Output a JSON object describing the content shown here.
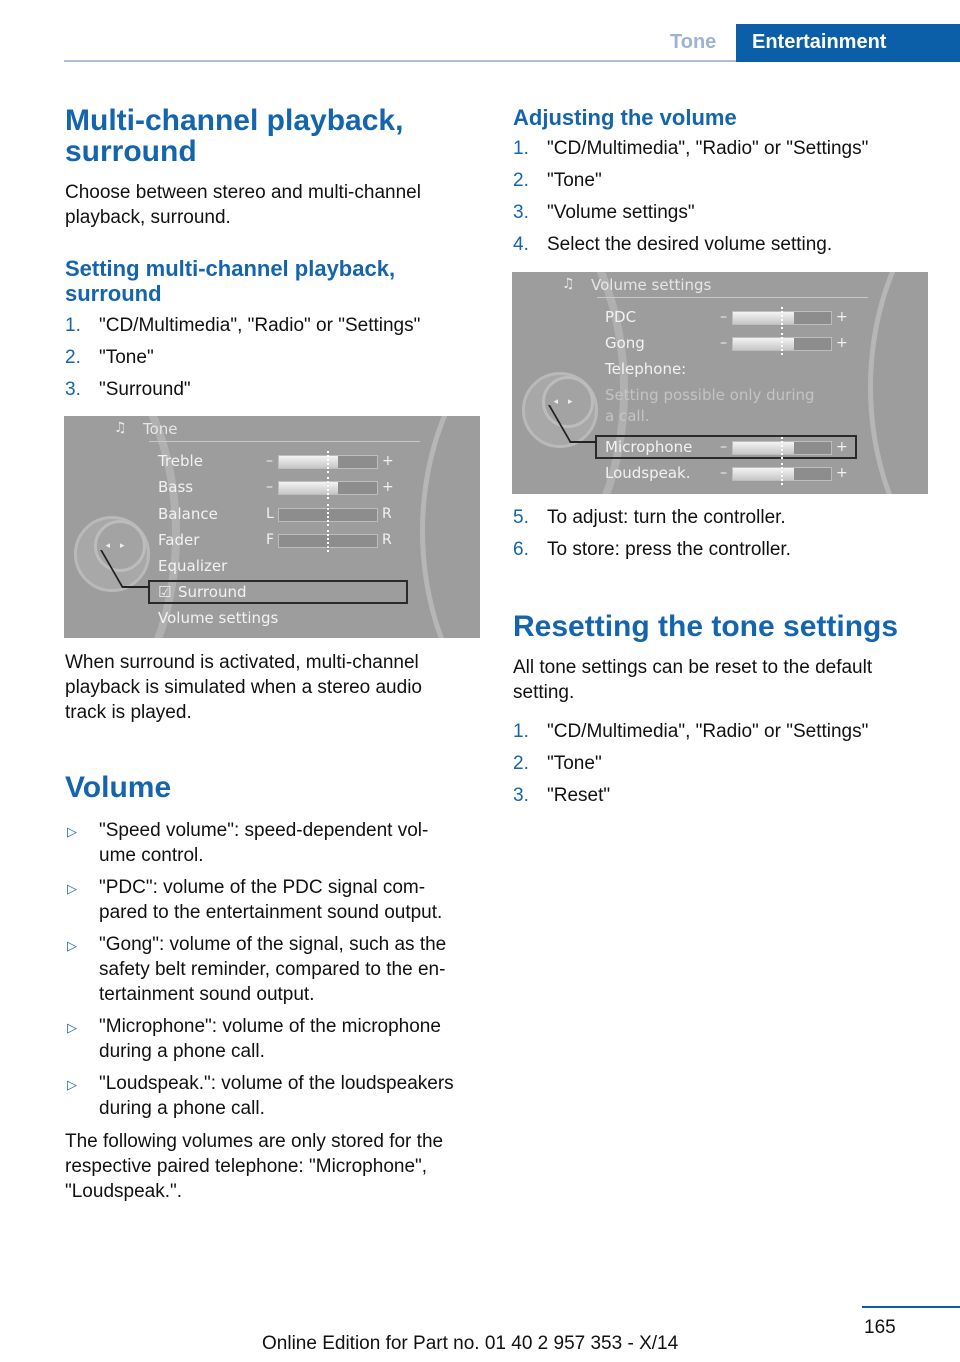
{
  "header": {
    "section": "Tone",
    "chapter": "Entertainment"
  },
  "left": {
    "title": "Multi-channel playback, surround",
    "intro": "Choose between stereo and multi-channel playback, surround.",
    "subtitle": "Setting multi-channel playback, surround",
    "steps": [
      {
        "n": "1.",
        "text": "\"CD/Multimedia\", \"Radio\" or \"Settings\""
      },
      {
        "n": "2.",
        "text": "\"Tone\""
      },
      {
        "n": "3.",
        "text": "\"Surround\""
      }
    ],
    "screen": {
      "title": "Tone",
      "rows": [
        {
          "label": "Treble",
          "left": "–",
          "right": "+",
          "value": 0.6
        },
        {
          "label": "Bass",
          "left": "–",
          "right": "+",
          "value": 0.6
        },
        {
          "label": "Balance",
          "left": "L",
          "right": "R",
          "value": 0
        },
        {
          "label": "Fader",
          "left": "F",
          "right": "R",
          "value": 0
        },
        {
          "label": "Equalizer"
        },
        {
          "label": "Surround",
          "checked": true,
          "selected": true
        },
        {
          "label": "Volume settings"
        }
      ]
    },
    "after": "When surround is activated, multi-channel playback is simulated when a stereo audio track is played.",
    "volume_title": "Volume",
    "bullets": [
      "\"Speed volume\": speed-dependent vol-ume control.",
      "\"PDC\": volume of the PDC signal com-pared to the entertainment sound output.",
      "\"Gong\": volume of the signal, such as the safety belt reminder, compared to the en-tertainment sound output.",
      "\"Microphone\": volume of the microphone during a phone call.",
      "\"Loudspeak.\": volume of the loudspeakers during a phone call."
    ],
    "bullet_lines": [
      [
        "\"Speed volume\": speed-dependent vol-",
        "ume control."
      ],
      [
        "\"PDC\": volume of the PDC signal com-",
        "pared to the entertainment sound output."
      ],
      [
        "\"Gong\": volume of the signal, such as the",
        "safety belt reminder, compared to the en-",
        "tertainment sound output."
      ],
      [
        "\"Microphone\": volume of the microphone",
        "during a phone call."
      ],
      [
        "\"Loudspeak.\": volume of the loudspeakers",
        "during a phone call."
      ]
    ],
    "note": "The following volumes are only stored for the respective paired telephone: \"Microphone\", \"Loudspeak.\"."
  },
  "right": {
    "subtitle": "Adjusting the volume",
    "steps": [
      {
        "n": "1.",
        "text": "\"CD/Multimedia\", \"Radio\" or \"Settings\""
      },
      {
        "n": "2.",
        "text": "\"Tone\""
      },
      {
        "n": "3.",
        "text": "\"Volume settings\""
      },
      {
        "n": "4.",
        "text": "Select the desired volume setting."
      }
    ],
    "screen": {
      "title": "Volume settings",
      "rows": [
        {
          "label": "PDC",
          "left": "–",
          "right": "+",
          "value": 0.62
        },
        {
          "label": "Gong",
          "left": "–",
          "right": "+",
          "value": 0.62
        },
        {
          "label": "Telephone:"
        },
        {
          "label": "Setting possible only during",
          "dim": true
        },
        {
          "label": "a call.",
          "dim": true
        },
        {
          "label": "Microphone",
          "left": "–",
          "right": "+",
          "value": 0.62,
          "selected": true
        },
        {
          "label": "Loudspeak.",
          "left": "–",
          "right": "+",
          "value": 0.62
        }
      ]
    },
    "steps2": [
      {
        "n": "5.",
        "text": "To adjust: turn the controller."
      },
      {
        "n": "6.",
        "text": "To store: press the controller."
      }
    ],
    "reset_title": "Resetting the tone settings",
    "reset_intro": "All tone settings can be reset to the default setting.",
    "reset_steps": [
      {
        "n": "1.",
        "text": "\"CD/Multimedia\", \"Radio\" or \"Settings\""
      },
      {
        "n": "2.",
        "text": "\"Tone\""
      },
      {
        "n": "3.",
        "text": "\"Reset\""
      }
    ]
  },
  "footer": {
    "page": "165",
    "edition": "Online Edition for Part no. 01 40 2 957 353 - X/14"
  },
  "colors": {
    "accent": "#1464ae",
    "header_tab": "#0a5fa8"
  }
}
